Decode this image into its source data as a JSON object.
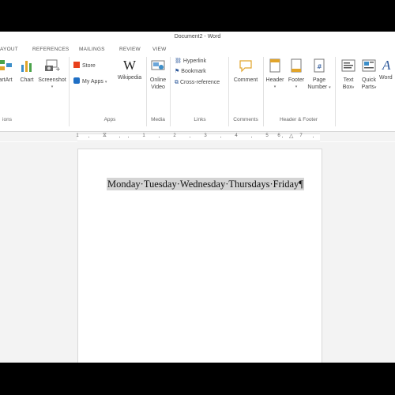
{
  "window": {
    "title": "Document2 - Word"
  },
  "tabs": [
    {
      "label": "AYOUT"
    },
    {
      "label": "REFERENCES"
    },
    {
      "label": "MAILINGS"
    },
    {
      "label": "REVIEW"
    },
    {
      "label": "VIEW"
    }
  ],
  "ribbon": {
    "groups": {
      "illustrations_partial": "ions",
      "apps": "Apps",
      "media": "Media",
      "links": "Links",
      "comments": "Comments",
      "header_footer": "Header & Footer"
    },
    "commands": {
      "smartart": "artArt",
      "chart": "Chart",
      "screenshot": "Screenshot",
      "store": "Store",
      "my_apps": "My Apps",
      "wikipedia": "Wikipedia",
      "online_video_line1": "Online",
      "online_video_line2": "Video",
      "hyperlink": "Hyperlink",
      "bookmark": "Bookmark",
      "cross_reference": "Cross-reference",
      "comment": "Comment",
      "header": "Header",
      "footer": "Footer",
      "page_number_line1": "Page",
      "page_number_line2": "Number",
      "text_box_line1": "Text",
      "text_box_line2": "Box",
      "quick_parts_line1": "Quick",
      "quick_parts_line2": "Parts",
      "wordart": "Word"
    }
  },
  "ruler": {
    "numbers": [
      "1",
      "1",
      "2",
      "3",
      "4",
      "5",
      "6",
      "7"
    ]
  },
  "document": {
    "text": "Monday·Tuesday·Wednesday·Thursdays·Friday",
    "pilcrow": "¶"
  },
  "colors": {
    "store": "#e8401c",
    "myapps": "#1f6fc5",
    "accent": "#2b579a",
    "selection": "#d4d4d4"
  }
}
